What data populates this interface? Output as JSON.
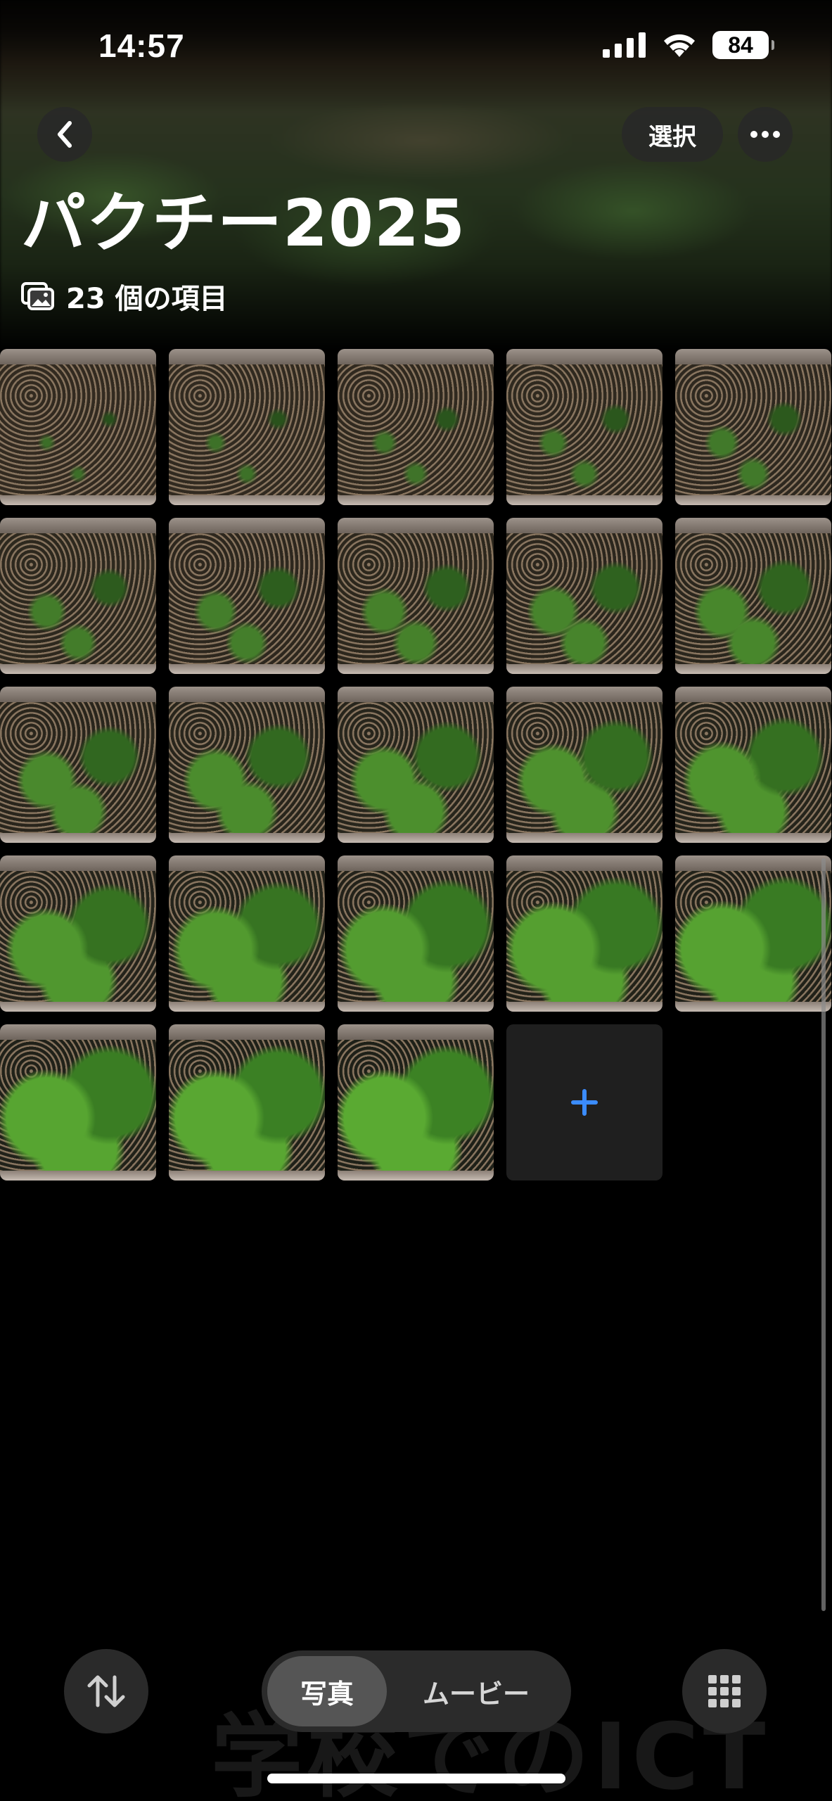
{
  "status_bar": {
    "time": "14:57",
    "battery": "84",
    "icons": [
      "signal-bars-icon",
      "wifi-icon",
      "battery-icon"
    ]
  },
  "nav": {
    "back_icon": "chevron-left-icon",
    "select_label": "選択",
    "more_icon": "ellipsis-icon"
  },
  "album": {
    "title": "パクチー2025",
    "count_icon": "photo-stack-icon",
    "count_text": "23 個の項目"
  },
  "photos": {
    "count": 23,
    "add_icon": "plus-icon",
    "accent_color": "#3b8cff"
  },
  "bottom_bar": {
    "sort_icon": "sort-arrows-icon",
    "segments": [
      {
        "label": "写真",
        "selected": true
      },
      {
        "label": "ムービー",
        "selected": false
      }
    ],
    "grid_icon": "grid-icon"
  },
  "watermark": "学校でのICT"
}
